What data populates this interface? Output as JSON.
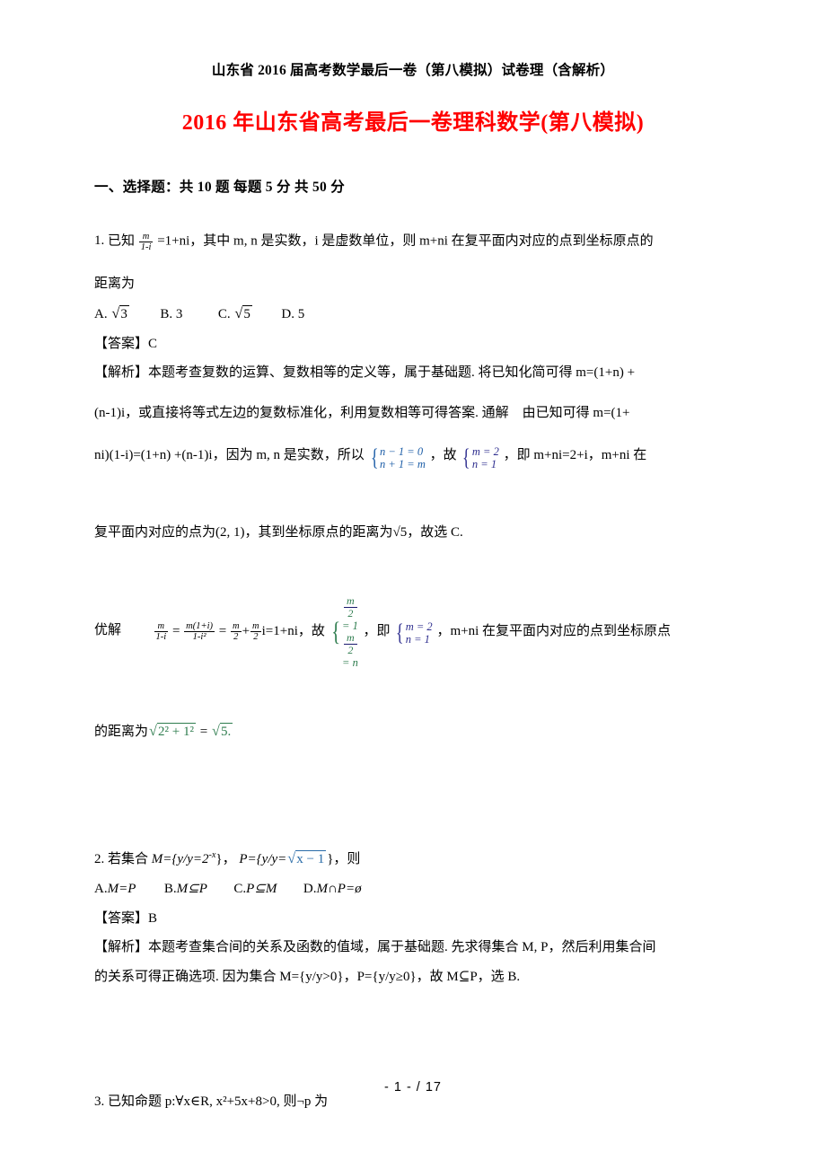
{
  "document": {
    "header_line": "山东省 2016 届高考数学最后一卷（第八模拟）试卷理（含解析）",
    "title": "2016 年山东省高考最后一卷理科数学(第八模拟)",
    "title_color": "#ff0000",
    "footer": "- 1 - / 17"
  },
  "section": {
    "heading": "一、选择题：共 10 题 每题 5 分 共 50 分"
  },
  "questions": [
    {
      "number": "1.",
      "stem_lead": "已知",
      "stem_frac_num": "m",
      "stem_frac_den": "1-i",
      "stem_after_frac": "=1+ni，其中 m, n 是实数，i 是虚数单位，则 m+ni 在复平面内对应的点到坐标原点的",
      "stem_line2": "距离为",
      "options": [
        {
          "label": "A.",
          "text": "√3"
        },
        {
          "label": "B.",
          "text": "3"
        },
        {
          "label": "C.",
          "text": "√5"
        },
        {
          "label": "D.",
          "text": "5"
        }
      ],
      "answer_label": "【答案】",
      "answer_value": "C",
      "analysis_label": "【解析】",
      "analysis_line1": "本题考查复数的运算、复数相等的定义等，属于基础题. 将已知化简可得 m=(1+n) +",
      "analysis_line2": "(n-1)i，或直接将等式左边的复数标准化，利用复数相等可得答案. 通解　由已知可得 m=(1+",
      "analysis_line3_a": "ni)(1-i)=(1+n) +(n-1)i，因为 m, n 是实数，所以",
      "analysis_line3_sys1": [
        "n − 1 = 0",
        "n + 1 = m"
      ],
      "analysis_line3_b": "，故",
      "analysis_line3_sys2": [
        "m = 2",
        "n = 1"
      ],
      "analysis_line3_c": "，即 m+ni=2+i，m+ni 在",
      "analysis_line4": "复平面内对应的点为(2, 1)，其到坐标原点的距离为√5，故选 C.",
      "better_label": "优解",
      "better_eq_f1_num": "m",
      "better_eq_f1_den": "1-i",
      "better_eq_f2_num": "m(1+i)",
      "better_eq_f2_den": "1-i²",
      "better_eq_f3_num": "m",
      "better_eq_f3_den": "2",
      "better_eq_f4_num": "m",
      "better_eq_f4_den": "2",
      "better_eq_tail": "i=1+ni，故",
      "better_sys1": [
        "m/2 = 1",
        "m/2 = n"
      ],
      "better_mid": "，即",
      "better_sys2": [
        "m = 2",
        "n = 1"
      ],
      "better_tail": "，m+ni 在复平面内对应的点到坐标原点",
      "better_line2_lead": "的距离为",
      "better_line2_radicand": "2² + 1²",
      "better_line2_eq": "=",
      "better_line2_result": "√5."
    },
    {
      "number": "2.",
      "stem_lead": "若集合",
      "stem_set_m": "M={y/y=2",
      "stem_set_m_exp": "-x",
      "stem_set_m_close": "}，",
      "stem_set_p": "P={y/y=",
      "stem_set_p_rad": "x − 1",
      "stem_set_p_close": "}，则",
      "options": [
        {
          "label": "A.",
          "text": "M=P"
        },
        {
          "label": "B.",
          "text": "M⊆P"
        },
        {
          "label": "C.",
          "text": "P⊆M"
        },
        {
          "label": "D.",
          "text": "M∩P=ø"
        }
      ],
      "answer_label": "【答案】",
      "answer_value": "B",
      "analysis_label": "【解析】",
      "analysis_line1": "本题考查集合间的关系及函数的值域，属于基础题. 先求得集合 M, P，然后利用集合间",
      "analysis_line2": "的关系可得正确选项. 因为集合 M={y/y>0}，P={y/y≥0}，故 M⊆P，选 B."
    },
    {
      "number": "3.",
      "stem": "已知命题 p:∀x∈R, x²+5x+8>0, 则¬p 为"
    }
  ]
}
